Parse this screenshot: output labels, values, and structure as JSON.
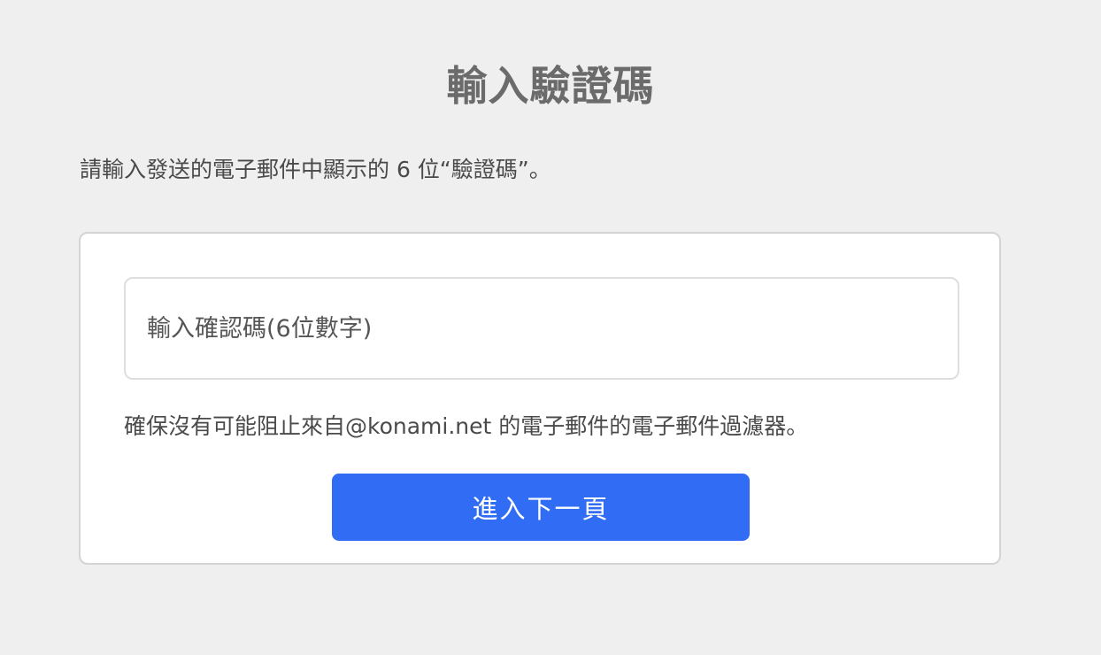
{
  "page": {
    "title": "輸入驗證碼",
    "instruction": "請輸入發送的電子郵件中顯示的 6 位“驗證碼”。"
  },
  "form": {
    "code_input": {
      "value": "",
      "placeholder": "輸入確認碼(6位數字)"
    },
    "notice": "確保沒有可能阻止來自@konami.net 的電子郵件的電子郵件過濾器。",
    "next_button_label": "進入下一頁"
  },
  "colors": {
    "background": "#efefef",
    "card_background": "#ffffff",
    "primary_button": "#316cf4",
    "title_text": "#6b6b6b",
    "body_text": "#4a4a4a"
  }
}
